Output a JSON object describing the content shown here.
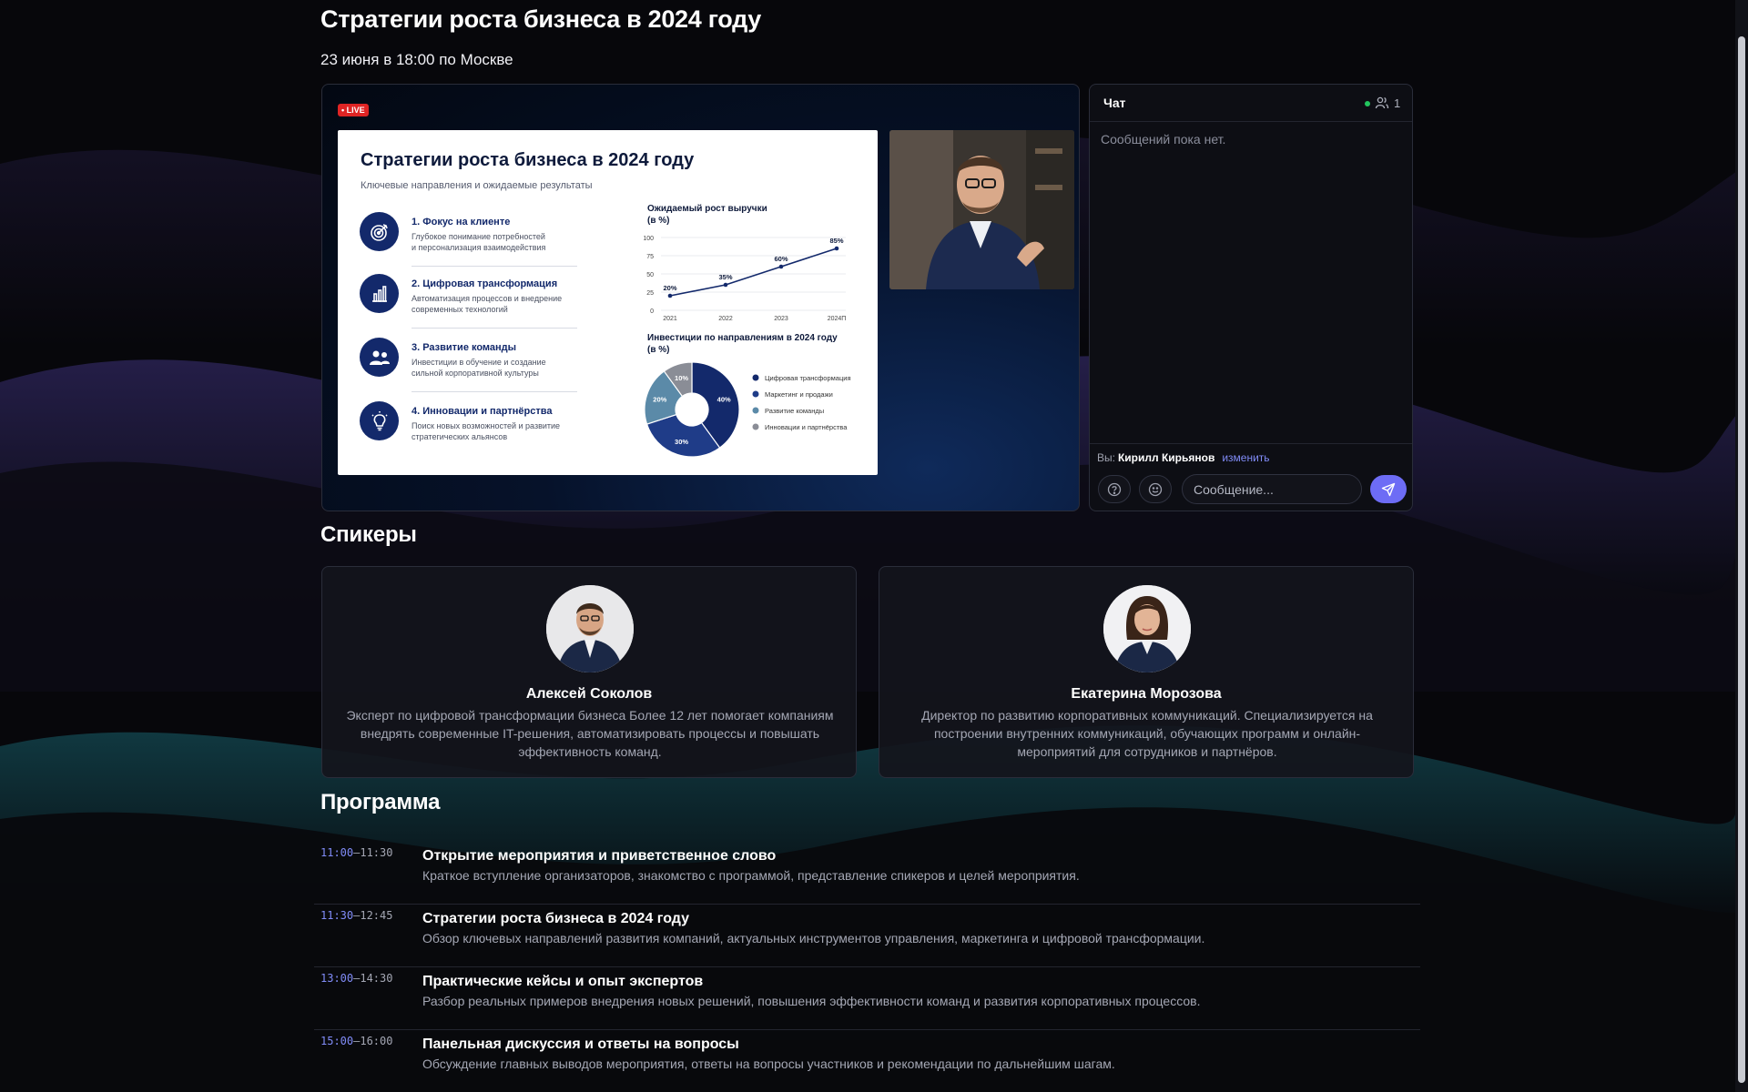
{
  "event": {
    "title": "Стратегии роста бизнеса в 2024 году",
    "date": "23 июня в 18:00 по Москве"
  },
  "video": {
    "live_badge": "• LIVE",
    "slide": {
      "title": "Стратегии роста бизнеса в 2024 году",
      "subtitle": "Ключевые направления и ожидаемые результаты",
      "focus_items": [
        {
          "title": "1. Фокус на клиенте",
          "line1": "Глубокое понимание потребностей",
          "line2": "и персонализация взаимодействия",
          "icon": "target-icon"
        },
        {
          "title": "2. Цифровая трансформация",
          "line1": "Автоматизация процессов и внедрение",
          "line2": "современных технологий",
          "icon": "bar-chart-icon"
        },
        {
          "title": "3. Развитие команды",
          "line1": "Инвестиции в обучение и создание",
          "line2": "сильной корпоративной культуры",
          "icon": "team-icon"
        },
        {
          "title": "4. Инновации и партнёрства",
          "line1": "Поиск новых возможностей и развитие",
          "line2": "стратегических альянсов",
          "icon": "lightbulb-icon"
        }
      ]
    }
  },
  "chart_data": [
    {
      "type": "line",
      "title_line1": "Ожидаемый рост выручки",
      "title_line2": "(в %)",
      "x": [
        "2021",
        "2022",
        "2023",
        "2024П"
      ],
      "values": [
        20,
        35,
        60,
        85
      ],
      "labels": [
        "20%",
        "35%",
        "60%",
        "85%"
      ],
      "yticks": [
        "0",
        "25",
        "50",
        "75",
        "100"
      ],
      "ylim": [
        0,
        100
      ],
      "color": "#13296b",
      "grid": true
    },
    {
      "type": "pie",
      "title_line1": "Инвестиции по направлениям в 2024 году",
      "title_line2": "(в %)",
      "slices": [
        {
          "name": "Цифровая трансформация",
          "value": 40,
          "label": "40%",
          "color": "#13296b"
        },
        {
          "name": "Маркетинг и продажи",
          "value": 30,
          "label": "30%",
          "color": "#1f3c88"
        },
        {
          "name": "Развитие команды",
          "value": 20,
          "label": "20%",
          "color": "#5b8aa8"
        },
        {
          "name": "Инновации и партнёрства",
          "value": 10,
          "label": "10%",
          "color": "#8a8d96"
        }
      ],
      "legend_position": "right"
    }
  ],
  "chat": {
    "title": "Чат",
    "online_count": "1",
    "empty_text": "Сообщений пока нет.",
    "you_label": "Вы:",
    "you_name": "Кирилл Кирьянов",
    "change_label": "изменить",
    "placeholder": "Сообщение...",
    "accent": "#6d6cf5"
  },
  "speakers": {
    "heading": "Спикеры",
    "items": [
      {
        "name": "Алексей Соколов",
        "bio": "Эксперт по цифровой трансформации бизнеса Более 12 лет помогает компаниям внедрять современные IT-решения, автоматизировать процессы и повышать эффективность команд."
      },
      {
        "name": "Екатерина Морозова",
        "bio": "Директор по развитию корпоративных коммуникаций. Специализируется на построении внутренних коммуникаций, обучающих программ и онлайн-мероприятий для сотрудников и партнёров."
      }
    ]
  },
  "program": {
    "heading": "Программа",
    "items": [
      {
        "start": "11:00",
        "end": "–11:30",
        "title": "Открытие мероприятия и приветственное слово",
        "desc": "Краткое вступление организаторов, знакомство с программой, представление спикеров и целей мероприятия."
      },
      {
        "start": "11:30",
        "end": "–12:45",
        "title": "Стратегии роста бизнеса в 2024 году",
        "desc": "Обзор ключевых направлений развития компаний, актуальных инструментов управления, маркетинга и цифровой трансформации."
      },
      {
        "start": "13:00",
        "end": "–14:30",
        "title": "Практические кейсы и опыт экспертов",
        "desc": "Разбор реальных примеров внедрения новых решений, повышения эффективности команд и развития корпоративных процессов."
      },
      {
        "start": "15:00",
        "end": "–16:00",
        "title": "Панельная дискуссия и ответы на вопросы",
        "desc": "Обсуждение главных выводов мероприятия, ответы на вопросы участников и рекомендации по дальнейшим шагам."
      }
    ]
  }
}
